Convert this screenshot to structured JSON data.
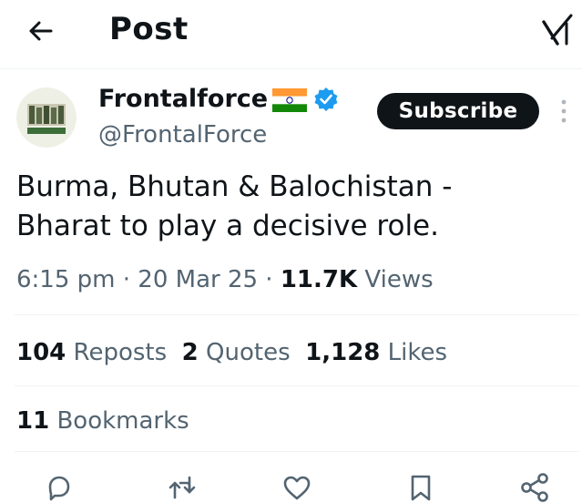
{
  "header": {
    "title": "Post"
  },
  "author": {
    "display_name": "Frontalforce",
    "handle": "@FrontalForce",
    "avatar_caption": "Frontal Force",
    "flag": "india-flag-icon",
    "verified": "verified-badge-icon"
  },
  "subscribe_label": "Subscribe",
  "tweet": {
    "line1": "Burma, Bhutan & Balochistan -",
    "line2": "Bharat to play a decisive role."
  },
  "meta": {
    "time": "6:15 pm",
    "sep1": " · ",
    "date": "20 Mar 25",
    "sep2": " · ",
    "views_count": "11.7K",
    "views_label": "Views"
  },
  "stats": {
    "reposts_count": "104",
    "reposts_label": "Reposts",
    "quotes_count": "2",
    "quotes_label": "Quotes",
    "likes_count": "1,128",
    "likes_label": "Likes"
  },
  "bookmarks": {
    "count": "11",
    "label": "Bookmarks"
  },
  "actions": [
    "reply-icon",
    "repost-icon",
    "like-icon",
    "bookmark-icon",
    "share-icon"
  ],
  "colors": {
    "text": "#0f1419",
    "secondary": "#536471",
    "verified": "#1d9bf0",
    "button": "#0f1419"
  }
}
